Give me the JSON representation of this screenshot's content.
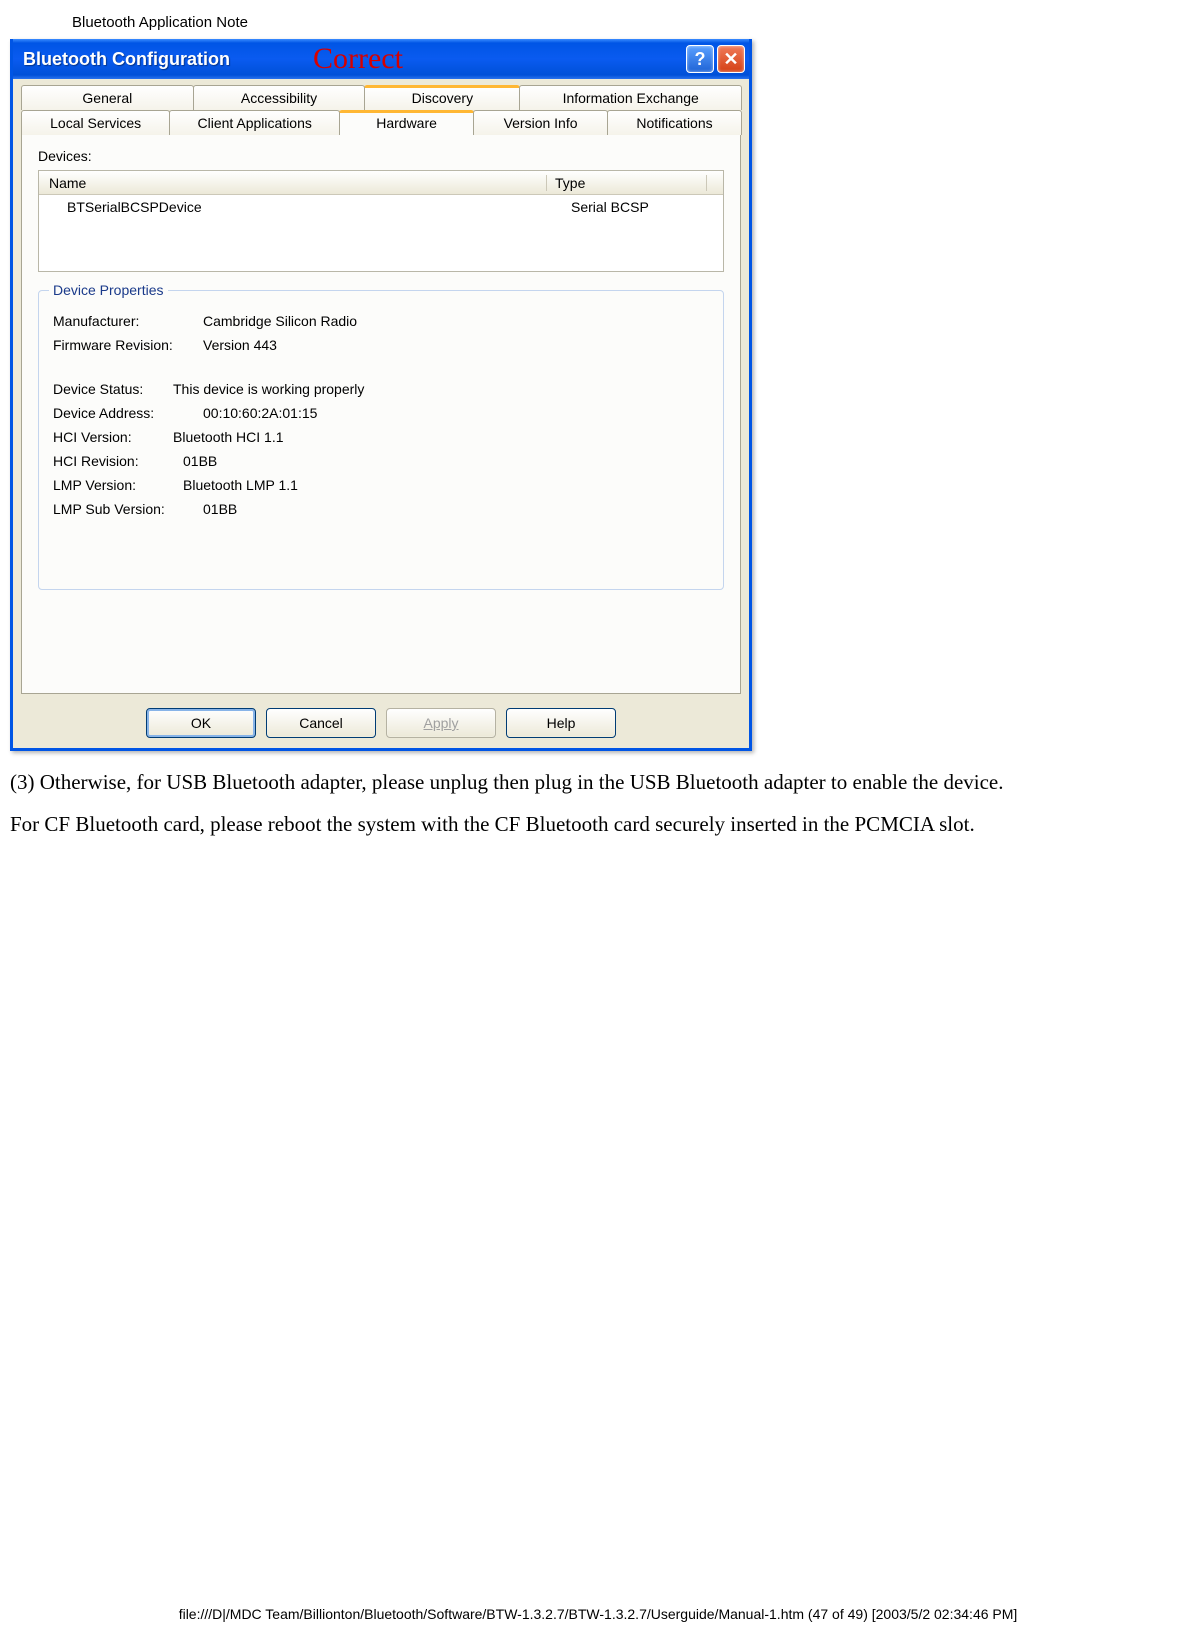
{
  "doc": {
    "header": "Bluetooth Application Note",
    "footer": "file:///D|/MDC Team/Billionton/Bluetooth/Software/BTW-1.3.2.7/BTW-1.3.2.7/Userguide/Manual-1.htm (47 of 49) [2003/5/2 02:34:46 PM]"
  },
  "dialog": {
    "title": "Bluetooth Configuration",
    "annotation": "Correct",
    "help_symbol": "?",
    "close_symbol": "✕",
    "tabs_row1": [
      "General",
      "Accessibility",
      "Discovery",
      "Information Exchange"
    ],
    "tabs_row2": [
      "Local Services",
      "Client Applications",
      "Hardware",
      "Version Info",
      "Notifications"
    ],
    "active_tab": "Hardware",
    "devices_label": "Devices:",
    "devices_columns": {
      "name": "Name",
      "type": "Type"
    },
    "devices_rows": [
      {
        "name": "BTSerialBCSPDevice",
        "type": "Serial BCSP"
      }
    ],
    "fieldset_title": "Device Properties",
    "properties": [
      {
        "label": "Manufacturer:",
        "value": "Cambridge Silicon Radio"
      },
      {
        "label": "Firmware Revision:",
        "value": "Version 443"
      },
      {
        "label": "",
        "value": ""
      },
      {
        "label": "Device Status:",
        "value": "This device is working properly"
      },
      {
        "label": "Device Address:",
        "value": "00:10:60:2A:01:15"
      },
      {
        "label": "HCI Version:",
        "value": "Bluetooth HCI 1.1"
      },
      {
        "label": "HCI Revision:",
        "value": "01BB"
      },
      {
        "label": "LMP Version:",
        "value": "Bluetooth LMP 1.1"
      },
      {
        "label": "LMP Sub Version:",
        "value": "01BB"
      }
    ],
    "buttons": {
      "ok": "OK",
      "cancel": "Cancel",
      "apply": "Apply",
      "help": "Help"
    }
  },
  "body": {
    "p1": "(3) Otherwise, for USB Bluetooth adapter, please unplug then plug in the USB Bluetooth adapter to enable the device.",
    "p2": "For CF Bluetooth card, please reboot the system with the CF Bluetooth card securely inserted in the PCMCIA slot."
  }
}
